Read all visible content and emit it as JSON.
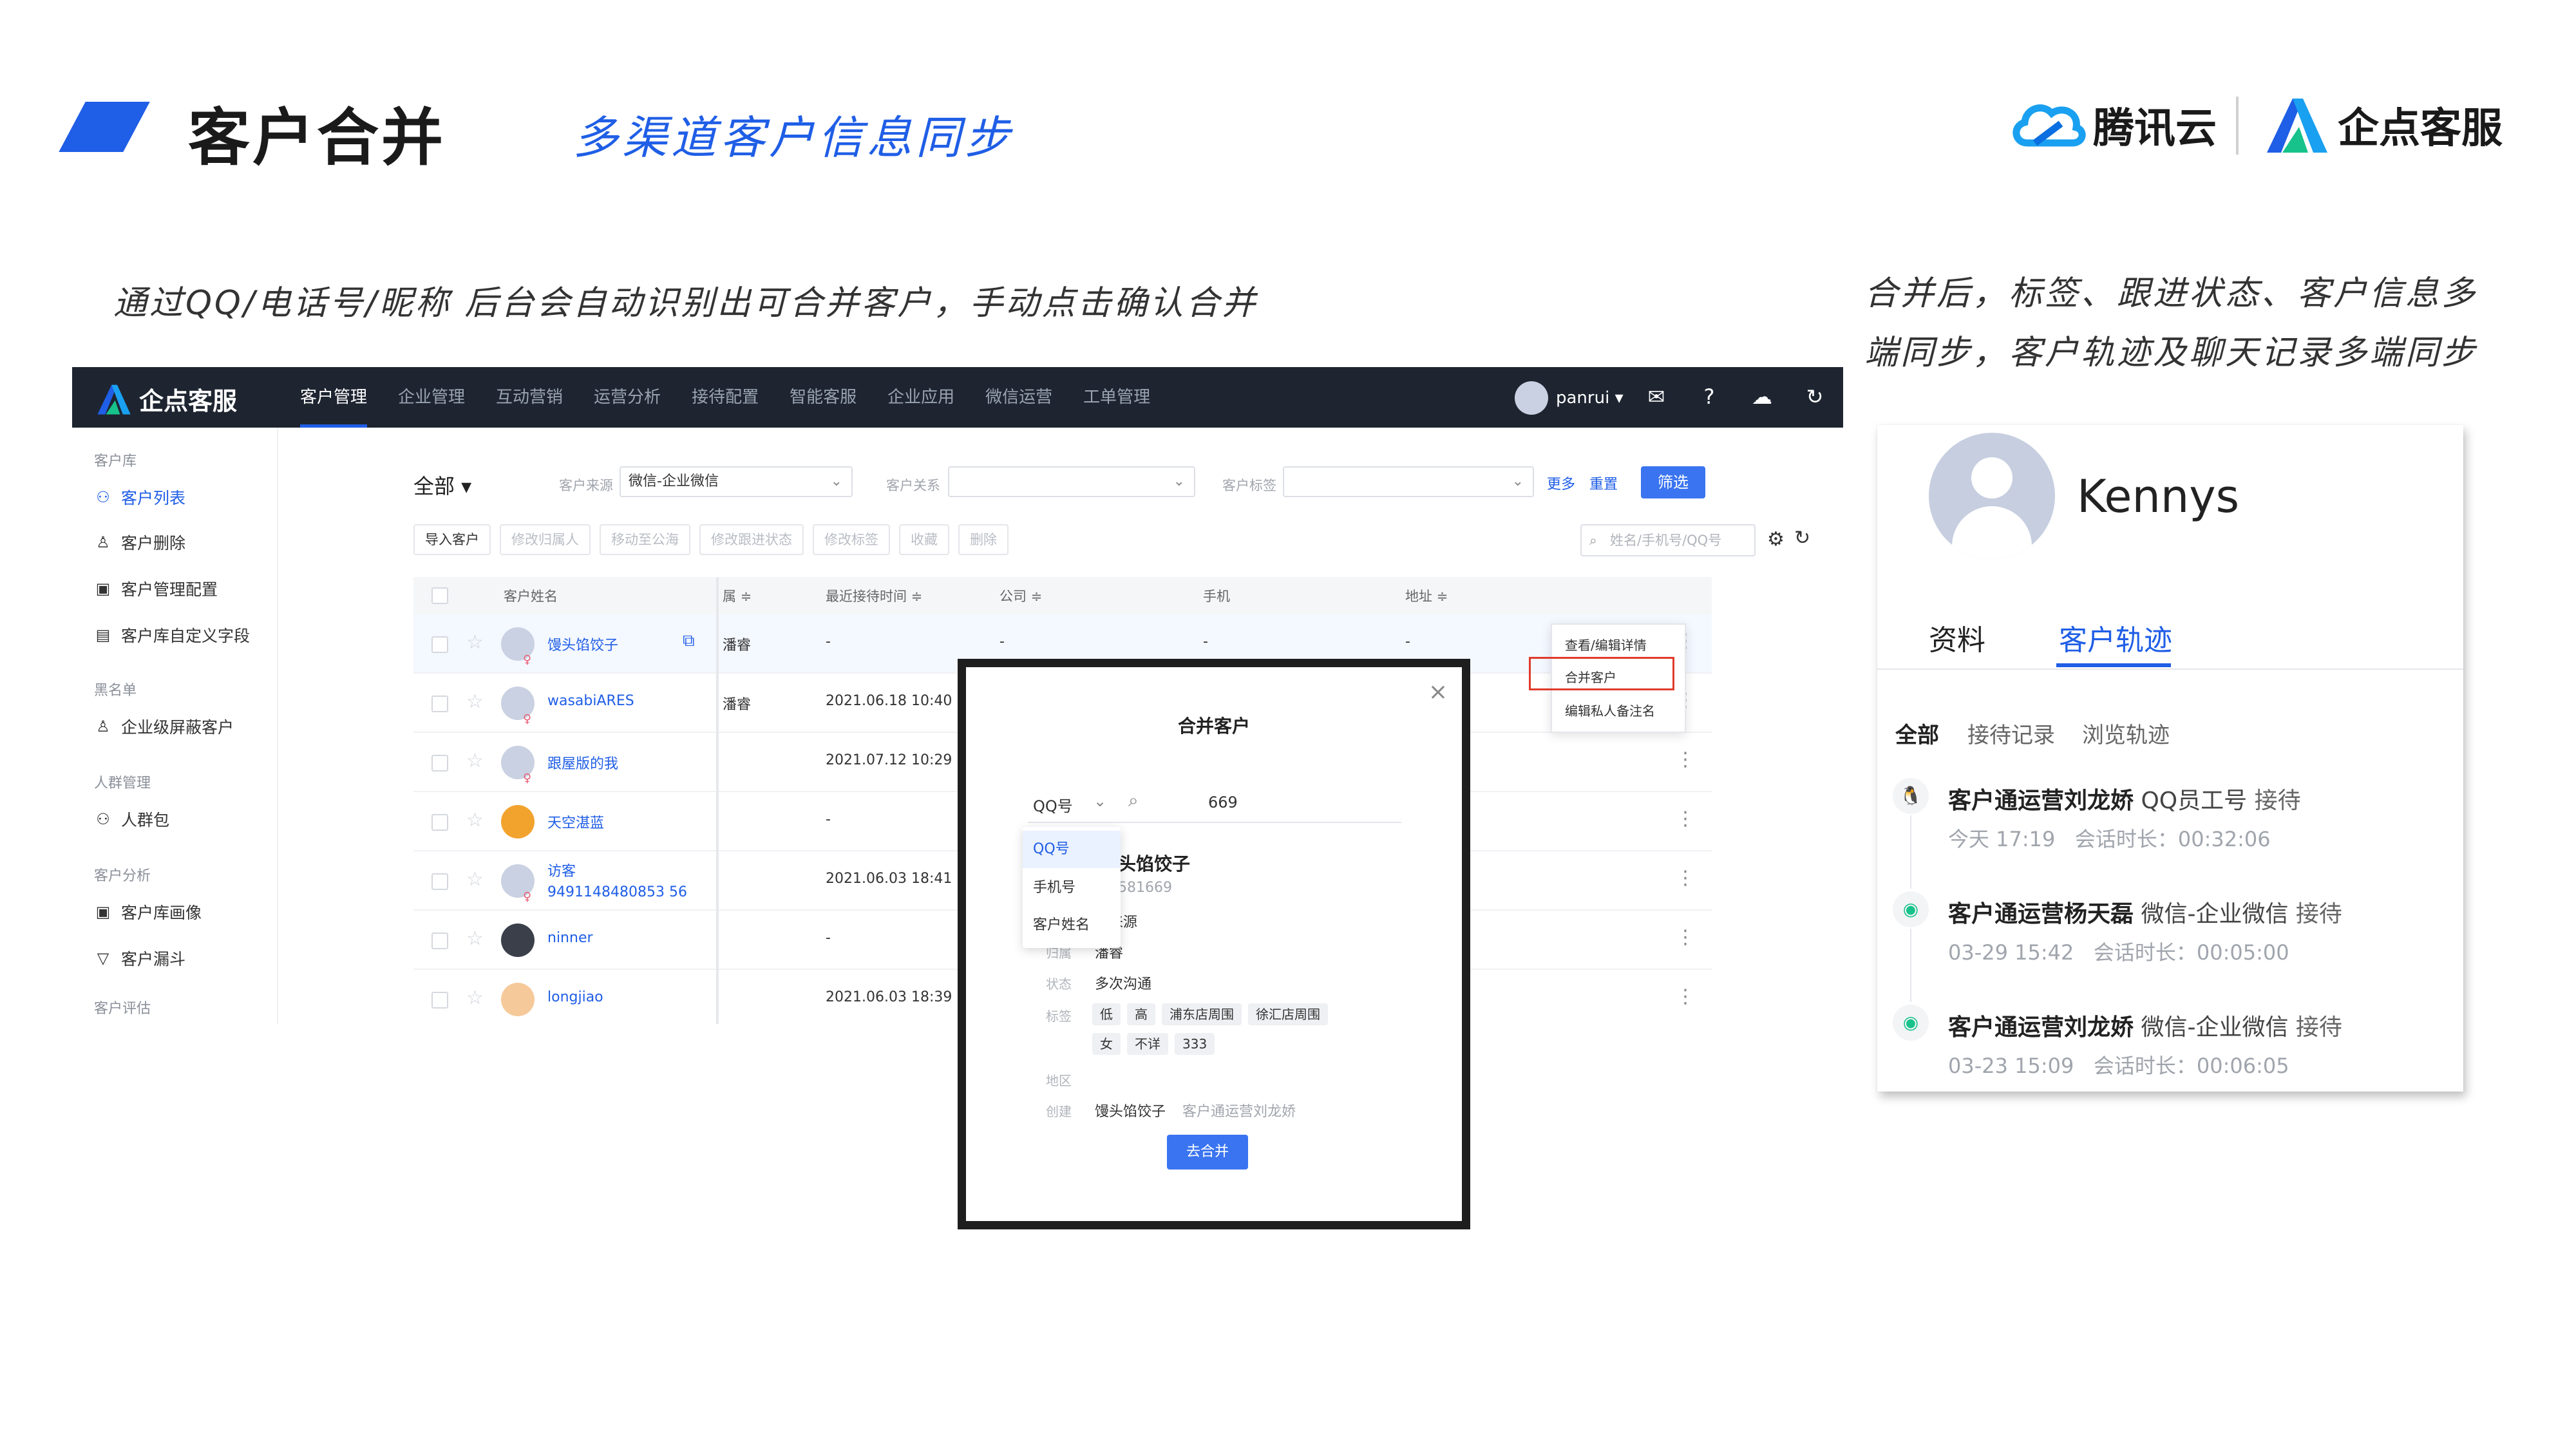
{
  "slide": {
    "title": "客户合并",
    "subtitle": "多渠道客户信息同步",
    "caption_left": "通过QQ/电话号/昵称   后台会自动识别出可合并客户，手动点击确认合并",
    "caption_right": "合并后，标签、跟进状态、客户信息多端同步，客户轨迹及聊天记录多端同步",
    "brand_tencent": "腾讯云",
    "brand_qidian": "企点客服"
  },
  "app": {
    "logo": "企点客服",
    "nav": [
      "客户管理",
      "企业管理",
      "互动营销",
      "运营分析",
      "接待配置",
      "智能客服",
      "企业应用",
      "微信运营",
      "工单管理"
    ],
    "user": "panrui ▾",
    "sidebar": {
      "g1": "客户库",
      "i1": "客户列表",
      "i2": "客户删除",
      "i3": "客户管理配置",
      "i4": "客户库自定义字段",
      "g2": "黑名单",
      "i5": "企业级屏蔽客户",
      "g3": "人群管理",
      "i6": "人群包",
      "g4": "客户分析",
      "i7": "客户库画像",
      "i8": "客户漏斗",
      "g5": "客户评估"
    },
    "filter": {
      "all": "全部 ▾",
      "source_label": "客户来源",
      "source_value": "微信-企业微信",
      "relation_label": "客户关系",
      "tag_label": "客户标签",
      "more": "更多",
      "reset": "重置",
      "submit": "筛选"
    },
    "actions": [
      "导入客户",
      "修改归属人",
      "移动至公海",
      "修改跟进状态",
      "修改标签",
      "收藏",
      "删除"
    ],
    "search_placeholder": "姓名/手机号/QQ号",
    "table": {
      "headers": {
        "name": "客户姓名",
        "owner": "属 ≑",
        "last": "最近接待时间 ≑",
        "company": "公司 ≑",
        "phone": "手机",
        "address": "地址 ≑"
      },
      "rows": [
        {
          "name": "馒头馅饺子",
          "owner": "潘睿",
          "last": "-",
          "company": "-",
          "phone": "-",
          "address": "-"
        },
        {
          "name": "wasabiARES",
          "owner": "潘睿",
          "last": "2021.06.18 10:40"
        },
        {
          "name": "跟屋版的我",
          "last": "2021.07.12 10:29"
        },
        {
          "name": "天空湛蓝",
          "last": "-"
        },
        {
          "name": "访客9491148480853 56",
          "last": "2021.06.03 18:41"
        },
        {
          "name": "ninner",
          "last": "-"
        },
        {
          "name": "longjiao",
          "last": "2021.06.03 18:39"
        }
      ]
    },
    "context_menu": [
      "查看/编辑详情",
      "合并客户",
      "编辑私人备注名"
    ]
  },
  "modal": {
    "title": "合并客户",
    "search_type": "QQ号",
    "search_value": "669",
    "dropdown": [
      "QQ号",
      "手机号",
      "客户姓名"
    ],
    "customer_name": "头馅饺子",
    "customer_id": "581669",
    "fields": {
      "source_value": "耶来源",
      "owner_key": "归属",
      "owner_value": "潘睿",
      "status_key": "状态",
      "status_value": "多次沟通",
      "tags_key": "标签",
      "region_key": "地区",
      "creator_key": "创建",
      "creator_value": "馒头馅饺子",
      "creator_agent": "客户通运营刘龙娇"
    },
    "tags": [
      "低",
      "高",
      "浦东店周围",
      "徐汇店周围",
      "女",
      "不详",
      "333"
    ],
    "button": "去合并"
  },
  "card": {
    "name": "Kennys",
    "tabs": [
      "资料",
      "客户轨迹"
    ],
    "filters": [
      "全部",
      "接待记录",
      "浏览轨迹"
    ],
    "events": [
      {
        "agent": "客户通运营刘龙娇",
        "channel": "QQ员工号",
        "action": "接待",
        "time": "今天 17:19",
        "duration": "会话时长：00:32:06"
      },
      {
        "agent": "客户通运营杨天磊",
        "channel": "微信-企业微信",
        "action": "接待",
        "time": "03-29 15:42",
        "duration": "会话时长：00:05:00"
      },
      {
        "agent": "客户通运营刘龙娇",
        "channel": "微信-企业微信",
        "action": "接待",
        "time": "03-23 15:09",
        "duration": "会话时长：00:06:05"
      }
    ]
  },
  "colors": {
    "accent": "#1f5ee6",
    "topbar": "#1e2531",
    "highlight": "#e03b2c"
  },
  "icons": [
    "slash-logo-icon",
    "tencent-cloud-icon",
    "qidian-logo-icon",
    "mail-icon",
    "help-icon",
    "cloud-icon",
    "refresh-icon",
    "qq-icon",
    "wechat-icon"
  ]
}
